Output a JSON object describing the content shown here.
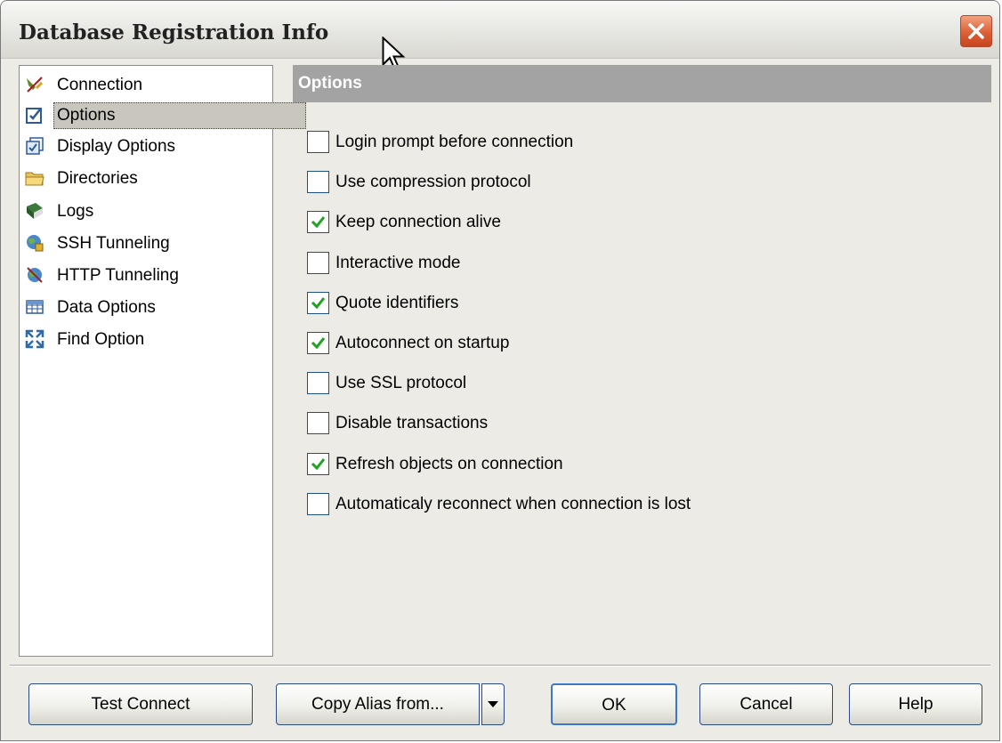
{
  "window": {
    "title": "Database Registration Info"
  },
  "nav": {
    "items": [
      {
        "label": "Connection",
        "icon": "connection-icon",
        "selected": false
      },
      {
        "label": "Options",
        "icon": "options-icon",
        "selected": true
      },
      {
        "label": "Display Options",
        "icon": "display-options-icon",
        "selected": false
      },
      {
        "label": "Directories",
        "icon": "folder-icon",
        "selected": false
      },
      {
        "label": "Logs",
        "icon": "log-book-icon",
        "selected": false
      },
      {
        "label": "SSH Tunneling",
        "icon": "ssh-globe-icon",
        "selected": false
      },
      {
        "label": "HTTP Tunneling",
        "icon": "http-globe-icon",
        "selected": false
      },
      {
        "label": "Data Options",
        "icon": "grid-icon",
        "selected": false
      },
      {
        "label": "Find Option",
        "icon": "find-arrows-icon",
        "selected": false
      }
    ]
  },
  "panel": {
    "header": "Options"
  },
  "options": [
    {
      "label": "Login prompt before connection",
      "checked": false
    },
    {
      "label": "Use compression protocol",
      "checked": false
    },
    {
      "label": "Keep connection alive",
      "checked": true
    },
    {
      "label": "Interactive mode",
      "checked": false
    },
    {
      "label": "Quote identifiers",
      "checked": true
    },
    {
      "label": "Autoconnect on startup",
      "checked": true
    },
    {
      "label": "Use SSL protocol",
      "checked": false
    },
    {
      "label": "Disable transactions",
      "checked": false
    },
    {
      "label": "Refresh objects on connection",
      "checked": true
    },
    {
      "label": "Automaticaly reconnect when connection is lost",
      "checked": false
    }
  ],
  "buttons": {
    "test_connect": "Test Connect",
    "copy_alias": "Copy Alias from...",
    "ok": "OK",
    "cancel": "Cancel",
    "help": "Help"
  },
  "colors": {
    "panel_header": "#a3a3a3",
    "check_mark": "#21a121",
    "close_button": "#dc5f37"
  }
}
